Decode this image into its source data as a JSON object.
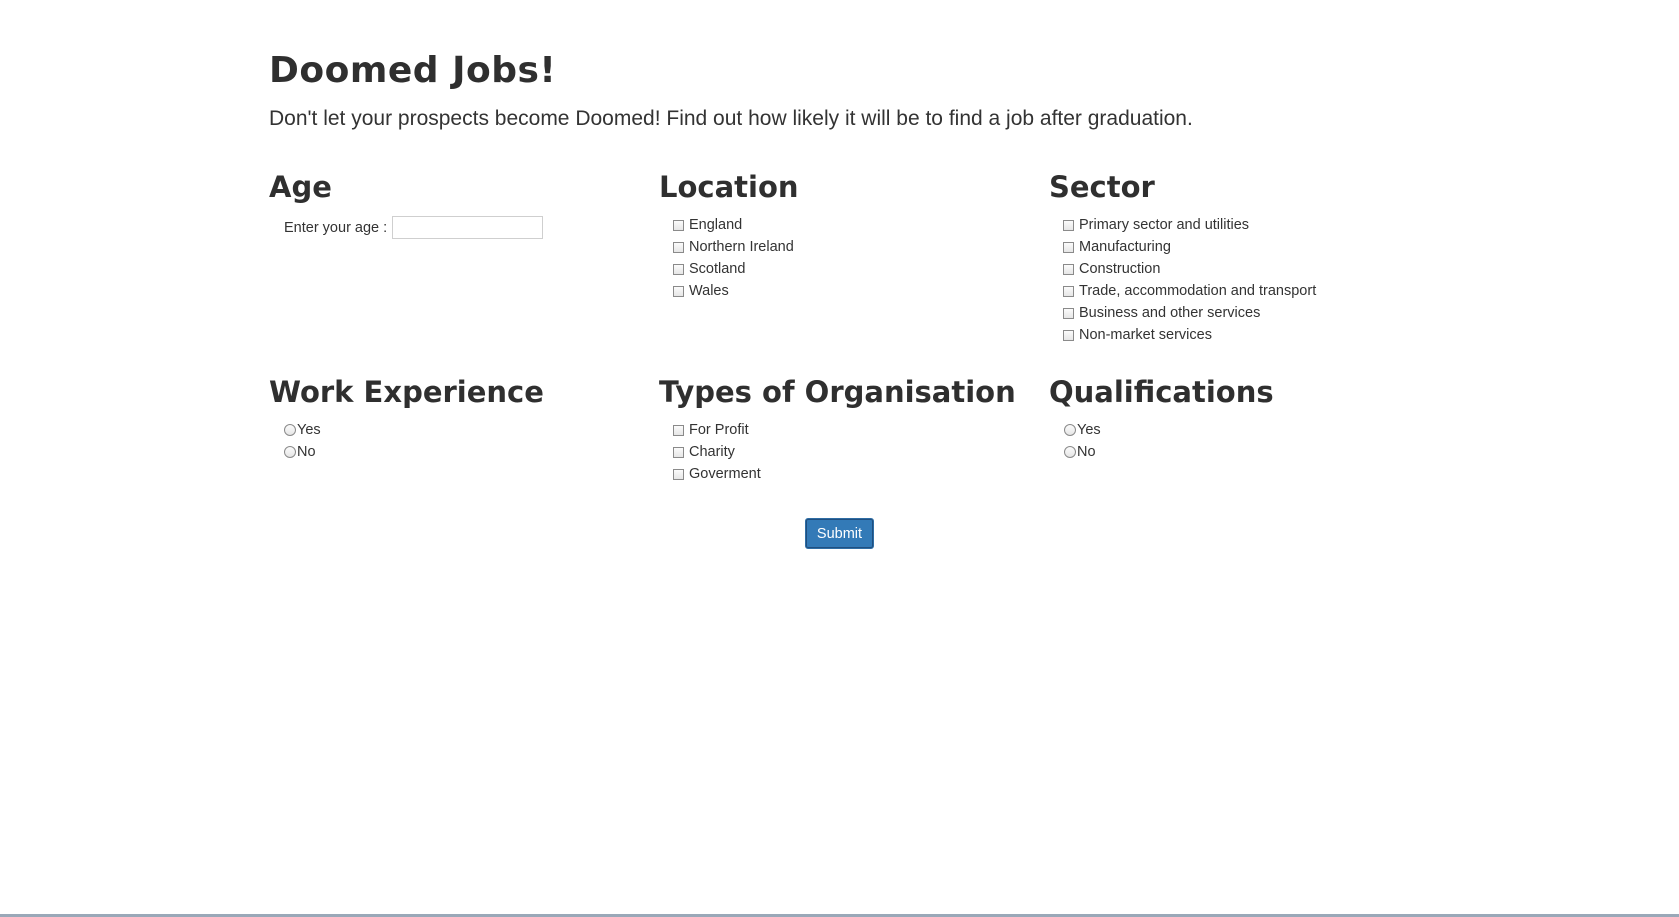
{
  "header": {
    "title": "Doomed Jobs!",
    "subtitle": "Don't let your prospects become Doomed! Find out how likely it will be to find a job after graduation."
  },
  "age": {
    "heading": "Age",
    "label": "Enter your age :",
    "value": "",
    "placeholder": ""
  },
  "location": {
    "heading": "Location",
    "options": [
      "England",
      "Northern Ireland",
      "Scotland",
      "Wales"
    ]
  },
  "sector": {
    "heading": "Sector",
    "options": [
      "Primary sector and utilities",
      "Manufacturing",
      "Construction",
      "Trade, accommodation and transport",
      "Business and other services",
      "Non-market services"
    ]
  },
  "work_experience": {
    "heading": "Work Experience",
    "options": [
      "Yes",
      "No"
    ]
  },
  "organisation": {
    "heading": "Types of Organisation",
    "options": [
      "For Profit",
      "Charity",
      "Goverment"
    ]
  },
  "qualifications": {
    "heading": "Qualifications",
    "options": [
      "Yes",
      "No"
    ]
  },
  "form": {
    "submit_label": "Submit"
  },
  "colors": {
    "button_primary": "#337ab7",
    "heading_text": "#2f2f2f",
    "body_text": "#333333"
  }
}
